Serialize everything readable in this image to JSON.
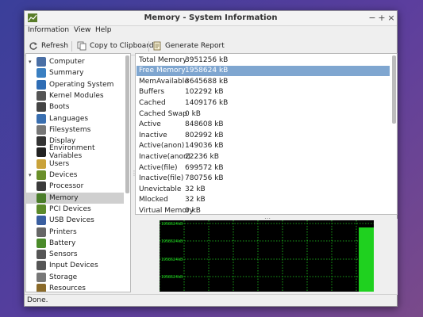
{
  "window": {
    "title": "Memory - System Information"
  },
  "menubar": {
    "items": [
      "Information",
      "View",
      "Help"
    ]
  },
  "toolbar": {
    "refresh": "Refresh",
    "copy": "Copy to Clipboard",
    "report": "Generate Report"
  },
  "sidebar": {
    "items": [
      {
        "label": "Computer",
        "icon": "computer-icon"
      },
      {
        "label": "Summary",
        "icon": "summary-icon"
      },
      {
        "label": "Operating System",
        "icon": "os-icon"
      },
      {
        "label": "Kernel Modules",
        "icon": "kernel-icon"
      },
      {
        "label": "Boots",
        "icon": "boots-icon"
      },
      {
        "label": "Languages",
        "icon": "languages-icon"
      },
      {
        "label": "Filesystems",
        "icon": "filesystems-icon"
      },
      {
        "label": "Display",
        "icon": "display-icon"
      },
      {
        "label": "Environment Variables",
        "icon": "terminal-icon"
      },
      {
        "label": "Users",
        "icon": "users-icon"
      },
      {
        "label": "Devices",
        "icon": "devices-icon"
      },
      {
        "label": "Processor",
        "icon": "processor-icon"
      },
      {
        "label": "Memory",
        "icon": "memory-icon"
      },
      {
        "label": "PCI Devices",
        "icon": "pci-icon"
      },
      {
        "label": "USB Devices",
        "icon": "usb-icon"
      },
      {
        "label": "Printers",
        "icon": "printer-icon"
      },
      {
        "label": "Battery",
        "icon": "battery-icon"
      },
      {
        "label": "Sensors",
        "icon": "sensors-icon"
      },
      {
        "label": "Input Devices",
        "icon": "input-devices-icon"
      },
      {
        "label": "Storage",
        "icon": "storage-icon"
      },
      {
        "label": "Resources",
        "icon": "resources-icon"
      }
    ],
    "selected": "Memory"
  },
  "memory_table": [
    {
      "key": "Total Memory",
      "value": "3951256 kB"
    },
    {
      "key": "Free Memory",
      "value": "1958624 kB"
    },
    {
      "key": "MemAvailable",
      "value": "3645688 kB"
    },
    {
      "key": "Buffers",
      "value": "102292 kB"
    },
    {
      "key": "Cached",
      "value": "1409176 kB"
    },
    {
      "key": "Cached Swap",
      "value": "0 kB"
    },
    {
      "key": "Active",
      "value": "848608 kB"
    },
    {
      "key": "Inactive",
      "value": "802992 kB"
    },
    {
      "key": "Active(anon)",
      "value": "149036 kB"
    },
    {
      "key": "Inactive(anon)",
      "value": "22236 kB"
    },
    {
      "key": "Active(file)",
      "value": "699572 kB"
    },
    {
      "key": "Inactive(file)",
      "value": "780756 kB"
    },
    {
      "key": "Unevictable",
      "value": "32 kB"
    },
    {
      "key": "Mlocked",
      "value": "32 kB"
    },
    {
      "key": "Virtual Memory",
      "value": "0 kB"
    }
  ],
  "selected_row": "Free Memory",
  "graph": {
    "labels": [
      "1958624kB",
      "1958624kB",
      "1958624kB",
      "1958624kB"
    ],
    "line_color": "#1fd11f"
  },
  "statusbar": {
    "text": "Done."
  }
}
